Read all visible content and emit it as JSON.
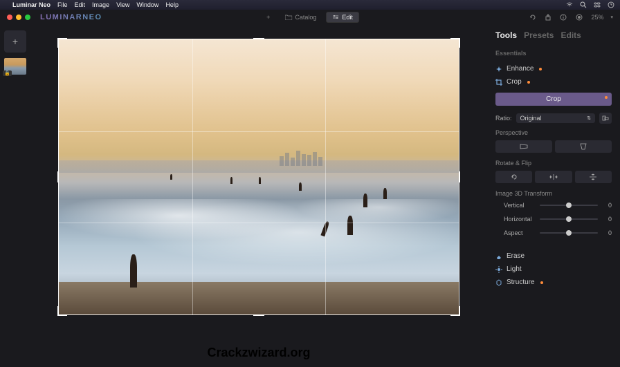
{
  "menubar": {
    "app": "Luminar Neo",
    "items": [
      "File",
      "Edit",
      "Image",
      "View",
      "Window",
      "Help"
    ]
  },
  "titlebar": {
    "app_title": "LUMINARNEO",
    "catalog_label": "Catalog",
    "edit_label": "Edit",
    "zoom": "25%"
  },
  "tabs": {
    "tools": "Tools",
    "presets": "Presets",
    "edits": "Edits"
  },
  "panel": {
    "essentials_label": "Essentials",
    "enhance": "Enhance",
    "crop": "Crop",
    "crop_btn": "Crop",
    "ratio_label": "Ratio:",
    "ratio_value": "Original",
    "perspective_label": "Perspective",
    "rotate_flip_label": "Rotate & Flip",
    "transform_label": "Image 3D Transform",
    "sliders": {
      "vertical": {
        "label": "Vertical",
        "value": "0"
      },
      "horizontal": {
        "label": "Horizontal",
        "value": "0"
      },
      "aspect": {
        "label": "Aspect",
        "value": "0"
      }
    },
    "erase": "Erase",
    "light": "Light",
    "structure": "Structure"
  },
  "watermark": "Crackzwizard.org"
}
